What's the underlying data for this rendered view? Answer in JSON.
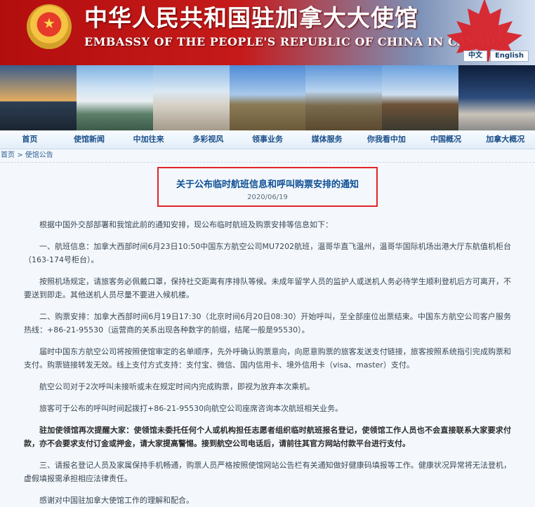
{
  "header": {
    "title_cn": "中华人民共和国驻加拿大大使馆",
    "title_en": "EMBASSY OF THE PEOPLE'S REPUBLIC OF CHINA IN CANADA",
    "lang_cn": "中文",
    "lang_en": "English"
  },
  "nav": {
    "items": [
      "首页",
      "使馆新闻",
      "中加往来",
      "多彩视风",
      "领事业务",
      "媒体服务",
      "你我看中加",
      "中国概况",
      "加拿大概况"
    ]
  },
  "breadcrumb": {
    "home": "首页",
    "separator": ">",
    "section": "使馆公告"
  },
  "article": {
    "title": "关于公布临时航班信息和呼叫购票安排的通知",
    "date": "2020/06/19",
    "paragraphs": [
      "根据中国外交部部署和我馆此前的通知安排，现公布临时航班及购票安排等信息如下：",
      "一、航班信息：加拿大西部时间6月23日10:50中国东方航空公司MU7202航班，温哥华直飞温州，温哥华国际机场出港大厅东航值机柜台（163-174号柜台）。",
      "按照机场规定，请旅客务必佩戴口罩，保持社交距离有序排队等候。未成年留学人员的监护人或送机人务必待学生顺利登机后方可离开，不要送到即走。其他送机人员尽量不要进入候机楼。",
      "二、购票安排：加拿大西部时间6月19日17:30（北京时间6月20日08:30）开始呼叫，至全部座位出票结束。中国东方航空公司客户服务热线：+86-21-95530（运营商的关系出现各种数字的前缀，结尾一般是95530）。",
      "届时中国东方航空公司将按照使馆审定的名单顺序，先外呼确认购票意向，向愿意购票的旅客发送支付链接，旅客按照系统指引完成购票和支付。购票链接转发无效。线上支付方式支持：支付宝、微信、国内信用卡、境外信用卡（visa、master）支付。",
      "航空公司对于2次呼叫未接听或未在规定时间内完成购票，即视为放弃本次乘机。",
      "旅客可于公布的呼叫时间起拨打+86-21-95530向航空公司座席咨询本次航班相关业务。",
      "三、请报名登记人员及家属保持手机畅通，购票人员严格按照使馆网站公告栏有关通知做好健康码填报等工作。健康状况异常将无法登机，虚假填报需承担相应法律责任。",
      "感谢对中国驻加拿大使馆工作的理解和配合。"
    ],
    "notice_bold": "驻加使领馆再次提醒大家：使领馆未委托任何个人或机构担任志愿者组织临时航班报名登记，使领馆工作人员也不会直接联系大家要求付款，亦不会要求支付订金或押金，请大家提高警惕。接到航空公司电话后，请前往其官方网站付款平台进行支付。"
  },
  "colors": {
    "banner_red": "#c61a1a",
    "link_blue": "#1b4f8a",
    "title_blue": "#0d4f95",
    "highlight_red": "#e3242b"
  },
  "icons": {
    "emblem": "national-emblem-icon",
    "maple": "maple-leaf-icon"
  }
}
